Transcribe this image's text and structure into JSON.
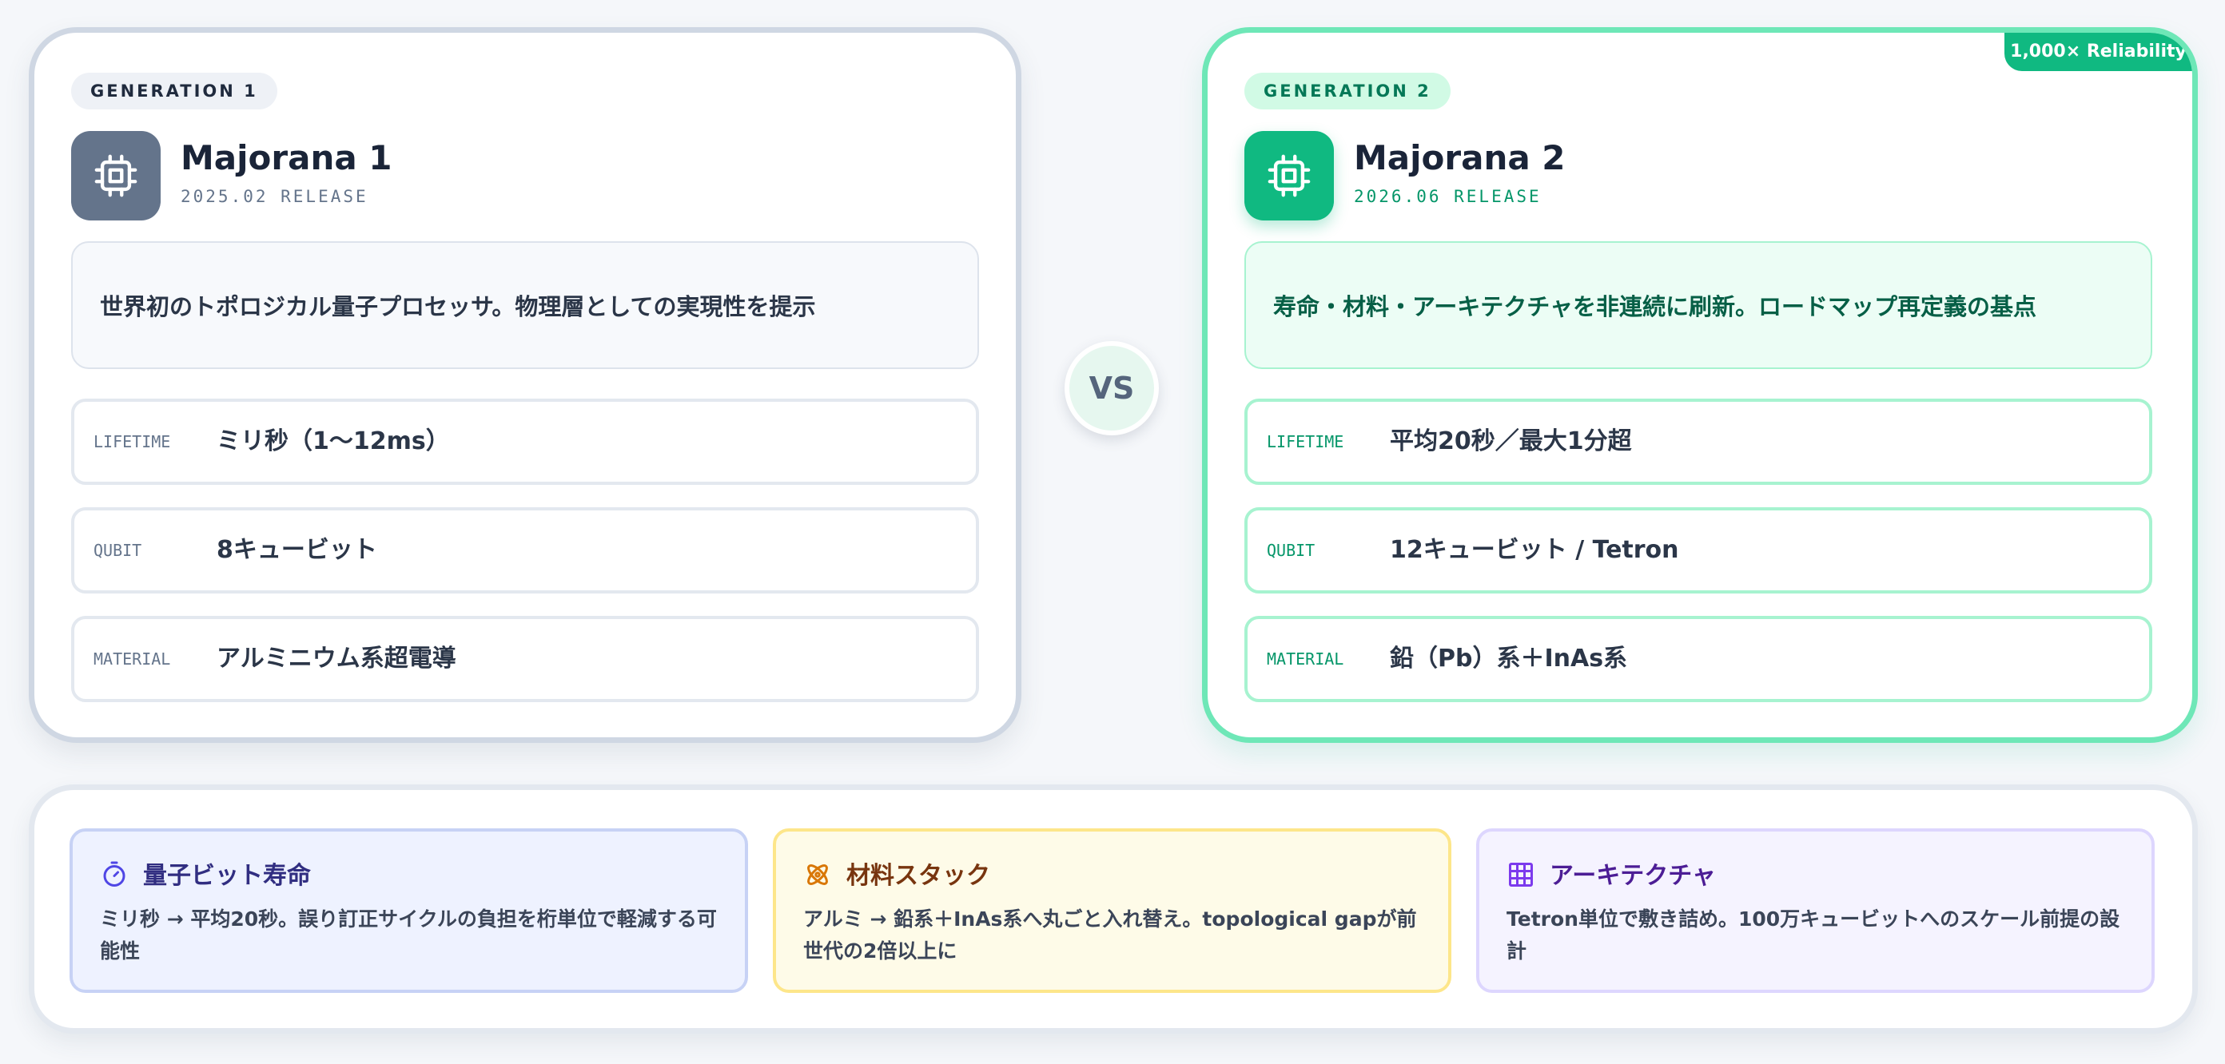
{
  "gen1": {
    "pill": "GENERATION 1",
    "title": "Majorana 1",
    "release": "2025.02 RELEASE",
    "icon": "chip-icon",
    "description": "世界初のトポロジカル量子プロセッサ。物理層としての実現性を提示",
    "specs": [
      {
        "key": "LIFETIME",
        "value": "ミリ秒（1〜12ms）"
      },
      {
        "key": "QUBIT",
        "value": "8キュービット"
      },
      {
        "key": "MATERIAL",
        "value": "アルミニウム系超電導"
      }
    ],
    "accent": "#64748b"
  },
  "vs_label": "VS",
  "gen2": {
    "ribbon": "1,000× Reliability",
    "pill": "GENERATION 2",
    "title": "Majorana 2",
    "release": "2026.06 RELEASE",
    "icon": "chip-icon",
    "description": "寿命・材料・アーキテクチャを非連続に刷新。ロードマップ再定義の基点",
    "specs": [
      {
        "key": "LIFETIME",
        "value": "平均20秒／最大1分超"
      },
      {
        "key": "QUBIT",
        "value": "12キュービット / Tetron"
      },
      {
        "key": "MATERIAL",
        "value": "鉛（Pb）系＋InAs系"
      }
    ],
    "accent": "#10b981"
  },
  "features": [
    {
      "icon": "stopwatch-icon",
      "title": "量子ビット寿命",
      "text": "ミリ秒 → 平均20秒。誤り訂正サイクルの負担を桁単位で軽減する可能性",
      "color": "#4f46e5"
    },
    {
      "icon": "atom-icon",
      "title": "材料スタック",
      "text": "アルミ → 鉛系＋InAs系へ丸ごと入れ替え。topological gapが前世代の2倍以上に",
      "color": "#d97706"
    },
    {
      "icon": "grid-icon",
      "title": "アーキテクチャ",
      "text": "Tetron単位で敷き詰め。100万キュービットへのスケール前提の設計",
      "color": "#7c3aed"
    }
  ]
}
